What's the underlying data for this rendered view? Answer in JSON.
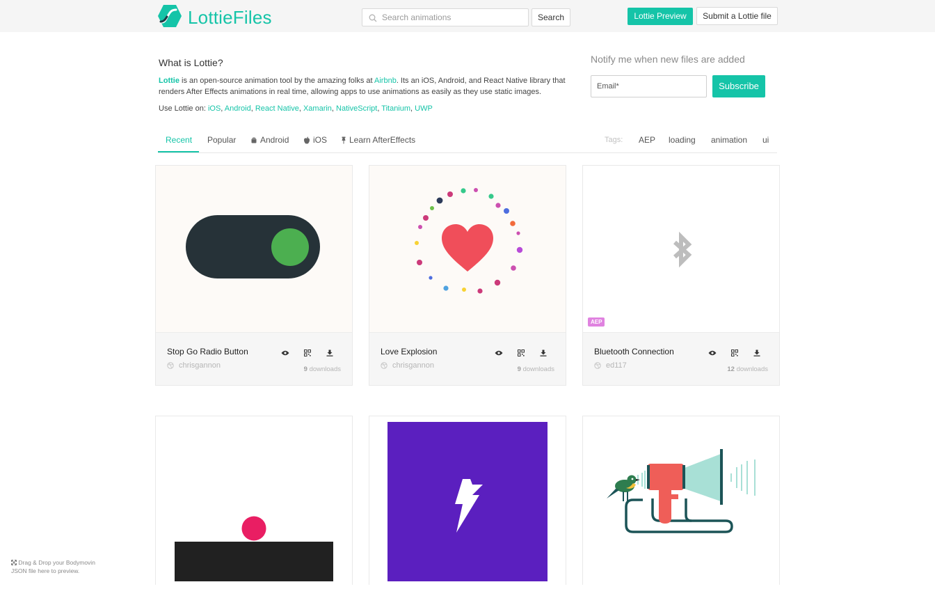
{
  "header": {
    "brand": "LottieFiles",
    "search_placeholder": "Search animations",
    "search_button": "Search",
    "preview_button": "Lottie Preview",
    "submit_button": "Submit a Lottie file"
  },
  "intro": {
    "title": "What is Lottie?",
    "lottie_word": "Lottie",
    "text_1": " is an open-source animation tool by the amazing folks at ",
    "airbnb": "Airbnb",
    "text_2": ". Its an iOS, Android, and React Native library that renders After Effects animations in real time, allowing apps to use animations as easily as they use static images.",
    "use_on_label": "Use Lottie on: ",
    "platforms": [
      "iOS",
      "Android",
      "React Native",
      "Xamarin",
      "NativeScript",
      "Titanium",
      "UWP"
    ]
  },
  "notify": {
    "title": "Notify me when new files are added",
    "email_placeholder": "Email*",
    "subscribe_button": "Subscribe"
  },
  "tabs": {
    "items": [
      {
        "label": "Recent",
        "icon": "",
        "active": true
      },
      {
        "label": "Popular",
        "icon": "",
        "active": false
      },
      {
        "label": "Android",
        "icon": "android-icon",
        "active": false
      },
      {
        "label": "iOS",
        "icon": "apple-icon",
        "active": false
      },
      {
        "label": "Learn AfterEffects",
        "icon": "pin-icon",
        "active": false
      }
    ],
    "tags_label": "Tags:",
    "tags": [
      "AEP",
      "loading",
      "animation",
      "ui"
    ]
  },
  "cards": [
    {
      "title": "Stop Go Radio Button",
      "author": "chrisgannon",
      "downloads": "9",
      "downloads_label": "downloads"
    },
    {
      "title": "Love Explosion",
      "author": "chrisgannon",
      "downloads": "9",
      "downloads_label": "downloads"
    },
    {
      "title": "Bluetooth Connection",
      "author": "ed117",
      "downloads": "12",
      "downloads_label": "downloads",
      "badge": "AEP"
    }
  ],
  "dropzone": {
    "line_1": "Drag & Drop your Bodymovin",
    "line_2": "JSON file here to preview."
  },
  "colors": {
    "accent": "#15c4a8",
    "aep_badge": "#e083e0"
  }
}
